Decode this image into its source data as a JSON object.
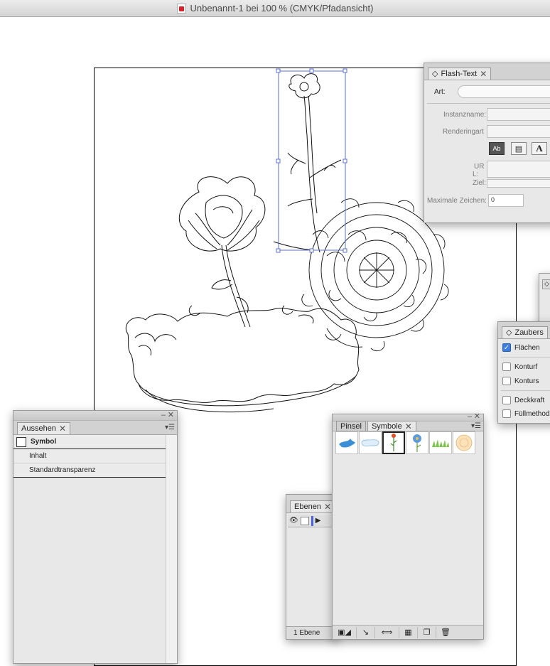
{
  "window": {
    "title": "Unbenannt-1 bei 100 % (CMYK/Pfadansicht)"
  },
  "aussehen": {
    "tab": "Aussehen",
    "rows": [
      "Symbol",
      "Inhalt",
      "Standardtransparenz"
    ]
  },
  "flash_text": {
    "tab": "Flash-Text",
    "art_label": "Art:",
    "instanzname_label": "Instanzname:",
    "renderingart_label": "Renderingart",
    "ur_label": "UR",
    "l_label": "L:",
    "ziel_label": "Ziel:",
    "max_label": "Maximale Zeichen:",
    "max_value": "0"
  },
  "zauberstab": {
    "tab": "Zaubers",
    "options": [
      {
        "label": "Flächen",
        "checked": true
      },
      {
        "label": "Konturf",
        "checked": false
      },
      {
        "label": "Konturs",
        "checked": false
      },
      {
        "label": "Deckkraft",
        "checked": false
      },
      {
        "label": "Füllmethod",
        "checked": false
      }
    ]
  },
  "ebenen": {
    "tab": "Ebenen",
    "count": "1 Ebene"
  },
  "symbole": {
    "tabs": [
      "Pinsel",
      "Symbole"
    ],
    "items": [
      "bird-symbol",
      "cloud-banner-symbol",
      "flower-stem-symbol",
      "blue-flower-symbol",
      "grass-symbol",
      "chrysanthemum-symbol"
    ]
  },
  "colors": {
    "selection": "#5a6fd6",
    "checkbox": "#3d7ddf"
  }
}
